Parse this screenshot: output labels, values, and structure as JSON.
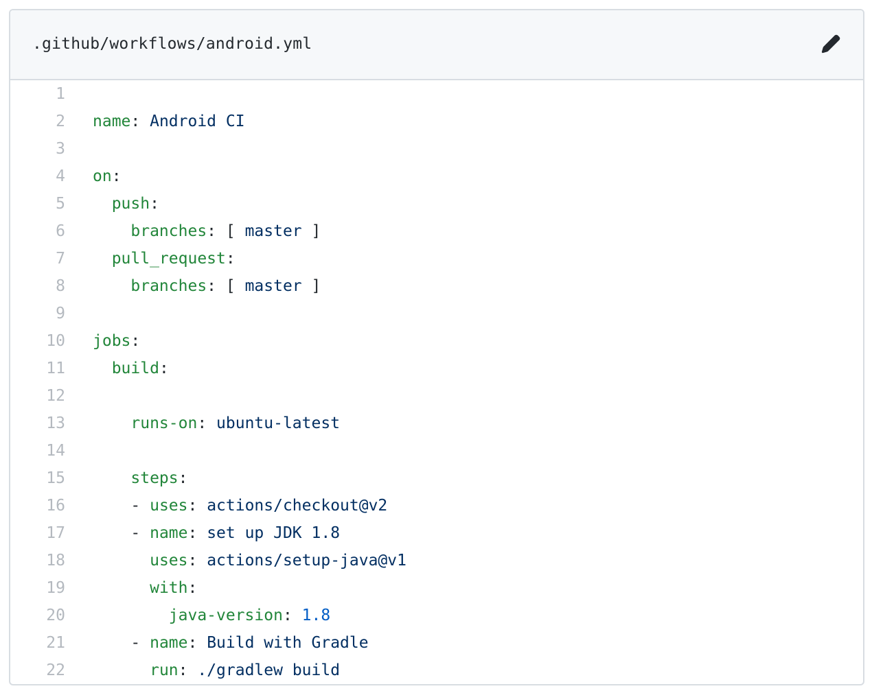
{
  "file": {
    "path": ".github/workflows/android.yml"
  },
  "icons": {
    "edit": "pencil-icon"
  },
  "colors": {
    "key": "#22863a",
    "string": "#032f62",
    "number": "#005cc5",
    "punct": "#24292e",
    "line_number": "#b4b9bf",
    "header_bg": "#f6f8fa",
    "border": "#d8dde2"
  },
  "lines": [
    {
      "n": "1",
      "tokens": []
    },
    {
      "n": "2",
      "tokens": [
        {
          "t": "name",
          "c": "k"
        },
        {
          "t": ": ",
          "c": "p"
        },
        {
          "t": "Android CI",
          "c": "s"
        }
      ]
    },
    {
      "n": "3",
      "tokens": []
    },
    {
      "n": "4",
      "tokens": [
        {
          "t": "on",
          "c": "k"
        },
        {
          "t": ":",
          "c": "p"
        }
      ]
    },
    {
      "n": "5",
      "tokens": [
        {
          "t": "  ",
          "c": "p"
        },
        {
          "t": "push",
          "c": "k"
        },
        {
          "t": ":",
          "c": "p"
        }
      ]
    },
    {
      "n": "6",
      "tokens": [
        {
          "t": "    ",
          "c": "p"
        },
        {
          "t": "branches",
          "c": "k"
        },
        {
          "t": ": [ ",
          "c": "p"
        },
        {
          "t": "master",
          "c": "s"
        },
        {
          "t": " ]",
          "c": "p"
        }
      ]
    },
    {
      "n": "7",
      "tokens": [
        {
          "t": "  ",
          "c": "p"
        },
        {
          "t": "pull_request",
          "c": "k"
        },
        {
          "t": ":",
          "c": "p"
        }
      ]
    },
    {
      "n": "8",
      "tokens": [
        {
          "t": "    ",
          "c": "p"
        },
        {
          "t": "branches",
          "c": "k"
        },
        {
          "t": ": [ ",
          "c": "p"
        },
        {
          "t": "master",
          "c": "s"
        },
        {
          "t": " ]",
          "c": "p"
        }
      ]
    },
    {
      "n": "9",
      "tokens": []
    },
    {
      "n": "10",
      "tokens": [
        {
          "t": "jobs",
          "c": "k"
        },
        {
          "t": ":",
          "c": "p"
        }
      ]
    },
    {
      "n": "11",
      "tokens": [
        {
          "t": "  ",
          "c": "p"
        },
        {
          "t": "build",
          "c": "k"
        },
        {
          "t": ":",
          "c": "p"
        }
      ]
    },
    {
      "n": "12",
      "tokens": []
    },
    {
      "n": "13",
      "tokens": [
        {
          "t": "    ",
          "c": "p"
        },
        {
          "t": "runs-on",
          "c": "k"
        },
        {
          "t": ": ",
          "c": "p"
        },
        {
          "t": "ubuntu-latest",
          "c": "s"
        }
      ]
    },
    {
      "n": "14",
      "tokens": []
    },
    {
      "n": "15",
      "tokens": [
        {
          "t": "    ",
          "c": "p"
        },
        {
          "t": "steps",
          "c": "k"
        },
        {
          "t": ":",
          "c": "p"
        }
      ]
    },
    {
      "n": "16",
      "tokens": [
        {
          "t": "    - ",
          "c": "p"
        },
        {
          "t": "uses",
          "c": "k"
        },
        {
          "t": ": ",
          "c": "p"
        },
        {
          "t": "actions/checkout@v2",
          "c": "s"
        }
      ]
    },
    {
      "n": "17",
      "tokens": [
        {
          "t": "    - ",
          "c": "p"
        },
        {
          "t": "name",
          "c": "k"
        },
        {
          "t": ": ",
          "c": "p"
        },
        {
          "t": "set up JDK 1.8",
          "c": "s"
        }
      ]
    },
    {
      "n": "18",
      "tokens": [
        {
          "t": "      ",
          "c": "p"
        },
        {
          "t": "uses",
          "c": "k"
        },
        {
          "t": ": ",
          "c": "p"
        },
        {
          "t": "actions/setup-java@v1",
          "c": "s"
        }
      ]
    },
    {
      "n": "19",
      "tokens": [
        {
          "t": "      ",
          "c": "p"
        },
        {
          "t": "with",
          "c": "k"
        },
        {
          "t": ":",
          "c": "p"
        }
      ]
    },
    {
      "n": "20",
      "tokens": [
        {
          "t": "        ",
          "c": "p"
        },
        {
          "t": "java-version",
          "c": "k"
        },
        {
          "t": ": ",
          "c": "p"
        },
        {
          "t": "1.8",
          "c": "n"
        }
      ]
    },
    {
      "n": "21",
      "tokens": [
        {
          "t": "    - ",
          "c": "p"
        },
        {
          "t": "name",
          "c": "k"
        },
        {
          "t": ": ",
          "c": "p"
        },
        {
          "t": "Build with Gradle",
          "c": "s"
        }
      ]
    },
    {
      "n": "22",
      "tokens": [
        {
          "t": "      ",
          "c": "p"
        },
        {
          "t": "run",
          "c": "k"
        },
        {
          "t": ": ",
          "c": "p"
        },
        {
          "t": "./gradlew build",
          "c": "s"
        }
      ]
    }
  ]
}
